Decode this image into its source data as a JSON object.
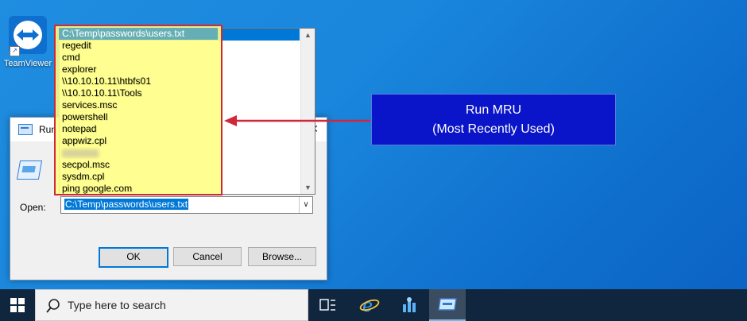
{
  "desktop": {
    "icons": [
      {
        "label": "TeamViewer",
        "icon": "teamviewer-icon"
      }
    ]
  },
  "run_dialog": {
    "title": "Run",
    "open_label": "Open:",
    "open_value": "C:\\Temp\\passwords\\users.txt",
    "buttons": {
      "ok": "OK",
      "cancel": "Cancel",
      "browse": "Browse..."
    }
  },
  "mru": {
    "items": [
      "C:\\Temp\\passwords\\users.txt",
      "regedit",
      "cmd",
      "explorer",
      "\\\\10.10.10.11\\htbfs01",
      "\\\\10.10.10.11\\Tools",
      "services.msc",
      "powershell",
      "notepad",
      "appwiz.cpl",
      "",
      "secpol.msc",
      "sysdm.cpl",
      "ping google.com"
    ],
    "selected_index": 0,
    "blurred_index": 10
  },
  "callout": {
    "line1": "Run MRU",
    "line2": "(Most Recently Used)",
    "background": "#0a14c8",
    "highlight_color": "#d0283a"
  },
  "taskbar": {
    "search_placeholder": "Type here to search",
    "icons": [
      "windows-start-icon",
      "search-icon",
      "task-view-icon",
      "internet-explorer-icon",
      "server-manager-icon",
      "run-icon"
    ]
  }
}
